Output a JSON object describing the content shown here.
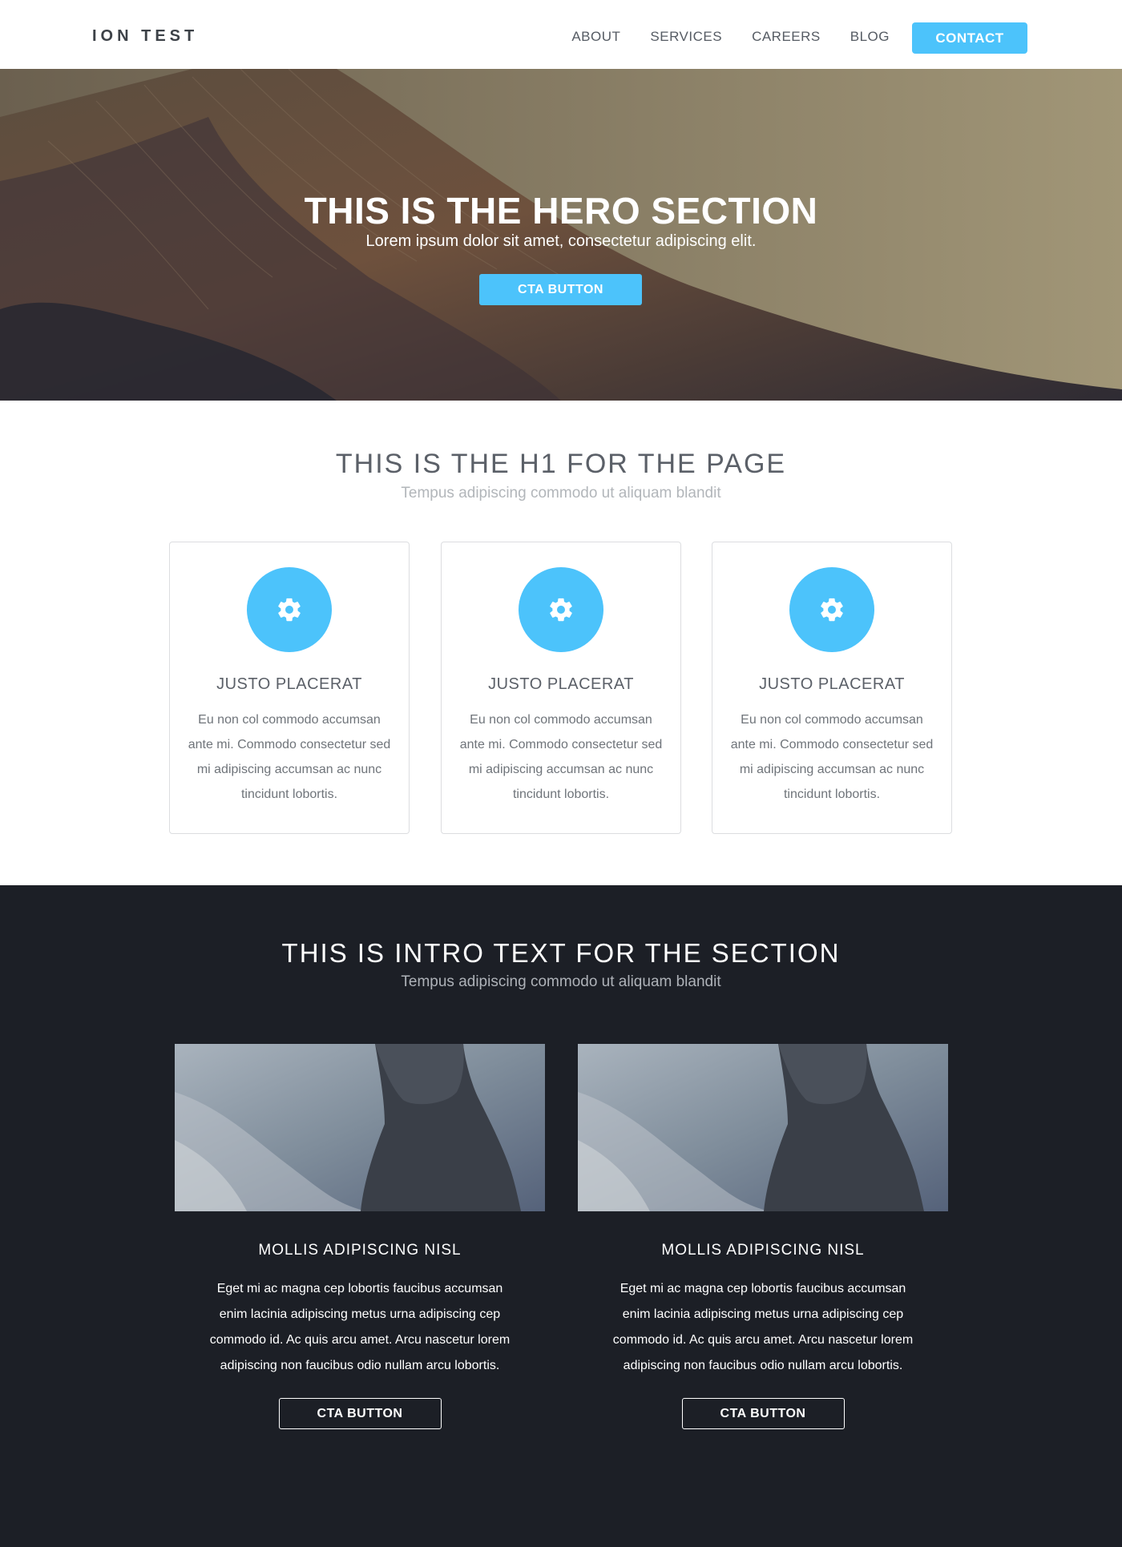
{
  "nav": {
    "logo": "ION TEST",
    "links": [
      "ABOUT",
      "SERVICES",
      "CAREERS",
      "BLOG"
    ],
    "contact": "CONTACT"
  },
  "hero": {
    "title": "THIS IS THE HERO SECTION",
    "subtitle": "Lorem ipsum dolor sit amet, consectetur adipiscing elit.",
    "cta": "CTA BUTTON"
  },
  "features": {
    "title": "THIS IS THE H1 FOR THE PAGE",
    "subtitle": "Tempus adipiscing commodo ut aliquam blandit",
    "cards": [
      {
        "icon": "gear-icon",
        "title": "JUSTO PLACERAT",
        "text": "Eu non col commodo accumsan ante mi. Commodo consectetur sed mi adipiscing accumsan ac nunc tincidunt lobortis."
      },
      {
        "icon": "gear-icon",
        "title": "JUSTO PLACERAT",
        "text": "Eu non col commodo accumsan ante mi. Commodo consectetur sed mi adipiscing accumsan ac nunc tincidunt lobortis."
      },
      {
        "icon": "gear-icon",
        "title": "JUSTO PLACERAT",
        "text": "Eu non col commodo accumsan ante mi. Commodo consectetur sed mi adipiscing accumsan ac nunc tincidunt lobortis."
      }
    ]
  },
  "intro": {
    "title": "THIS IS INTRO TEXT FOR THE SECTION",
    "subtitle": "Tempus adipiscing commodo ut aliquam blandit",
    "columns": [
      {
        "title": "MOLLIS ADIPISCING NISL",
        "text": "Eget mi ac magna cep lobortis faucibus accumsan enim lacinia adipiscing metus urna adipiscing cep commodo id. Ac quis arcu amet. Arcu nascetur lorem adipiscing non faucibus odio nullam arcu lobortis.",
        "cta": "CTA BUTTON"
      },
      {
        "title": "MOLLIS ADIPISCING NISL",
        "text": "Eget mi ac magna cep lobortis faucibus accumsan enim lacinia adipiscing metus urna adipiscing cep commodo id. Ac quis arcu amet. Arcu nascetur lorem adipiscing non faucibus odio nullam arcu lobortis.",
        "cta": "CTA BUTTON"
      }
    ]
  },
  "colors": {
    "accent": "#4cc3fb",
    "dark_bg": "#1c1f26",
    "text": "#5b6068"
  }
}
